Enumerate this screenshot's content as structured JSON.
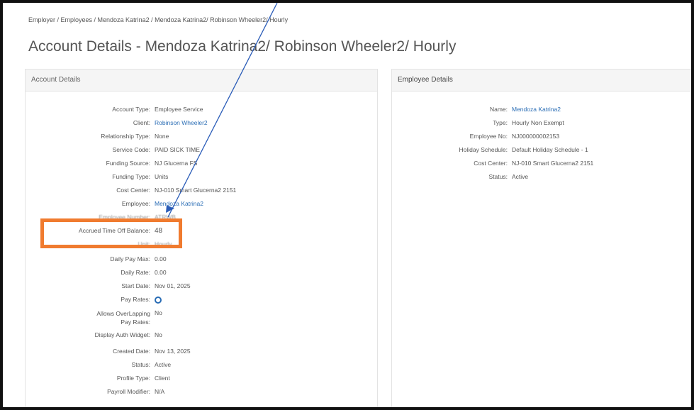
{
  "breadcrumb": "Employer / Employees / Mendoza Katrina2 / Mendoza Katrina2/ Robinson Wheeler2/ Hourly",
  "page_title": "Account Details - Mendoza Katrina2/ Robinson Wheeler2/ Hourly",
  "account_panel": {
    "title": "Account Details",
    "rows": [
      {
        "label": "Account Type:",
        "value": "Employee Service",
        "link": false
      },
      {
        "label": "Client:",
        "value": "Robinson Wheeler2",
        "link": true
      },
      {
        "label": "Relationship Type:",
        "value": "None",
        "link": false
      },
      {
        "label": "Service Code:",
        "value": "PAID SICK TIME",
        "link": false
      },
      {
        "label": "Funding Source:",
        "value": "NJ Glucerna FS",
        "link": false
      },
      {
        "label": "Funding Type:",
        "value": "Units",
        "link": false
      },
      {
        "label": "Cost Center:",
        "value": "NJ-010 Smart Glucerna2 2151",
        "link": false
      },
      {
        "label": "Employee:",
        "value": "Mendoza Katrina2",
        "link": true
      },
      {
        "label": "Employee Number:",
        "value": "ATRWB",
        "link": false
      },
      {
        "label": "Accrued Time Off Balance:",
        "value": "48",
        "link": false
      },
      {
        "label": "Unit:",
        "value": "Hourly",
        "link": false
      },
      {
        "label": "Daily Pay Max:",
        "value": "0.00",
        "link": false
      },
      {
        "label": "Daily Rate:",
        "value": "0.00",
        "link": false
      },
      {
        "label": "Start Date:",
        "value": "Nov 01, 2025",
        "link": false
      },
      {
        "label": "Pay Rates:",
        "value": "",
        "link": false
      },
      {
        "label": "Allows OverLapping Pay Rates:",
        "value": "No",
        "link": false
      },
      {
        "label": "Display Auth Widget:",
        "value": "No",
        "link": false
      },
      {
        "label": "Created Date:",
        "value": "Nov 13, 2025",
        "link": false
      },
      {
        "label": "Status:",
        "value": "Active",
        "link": false
      },
      {
        "label": "Profile Type:",
        "value": "Client",
        "link": false
      },
      {
        "label": "Payroll Modifier:",
        "value": "N/A",
        "link": false
      }
    ]
  },
  "employee_panel": {
    "title": "Employee Details",
    "rows": [
      {
        "label": "Name:",
        "value": "Mendoza Katrina2",
        "link": true
      },
      {
        "label": "Type:",
        "value": "Hourly Non Exempt",
        "link": false
      },
      {
        "label": "Employee No:",
        "value": "NJ000000002153",
        "link": false
      },
      {
        "label": "Holiday Schedule:",
        "value": "Default Holiday Schedule - 1",
        "link": false
      },
      {
        "label": "Cost Center:",
        "value": "NJ-010 Smart Glucerna2 2151",
        "link": false
      },
      {
        "label": "Status:",
        "value": "Active",
        "link": false
      }
    ]
  },
  "colors": {
    "link": "#2a6db5",
    "highlight": "#f07b2f",
    "annotation_line": "#2a5cb8"
  },
  "icons": {
    "pay_rates": "gear-icon"
  }
}
